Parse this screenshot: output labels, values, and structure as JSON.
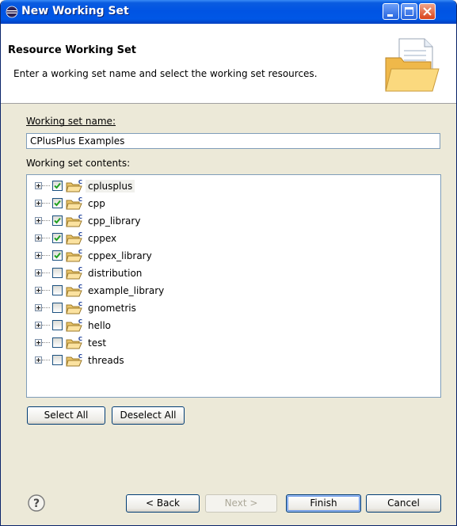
{
  "window": {
    "title": "New Working Set"
  },
  "banner": {
    "title": "Resource Working Set",
    "description": "Enter a working set name and select the working set resources."
  },
  "form": {
    "name_label": "Working set name:",
    "name_value": "CPlusPlus Examples",
    "contents_label": "Working set contents:"
  },
  "tree": {
    "items": [
      {
        "label": "cplusplus",
        "checked": true,
        "selected": true
      },
      {
        "label": "cpp",
        "checked": true,
        "selected": false
      },
      {
        "label": "cpp_library",
        "checked": true,
        "selected": false
      },
      {
        "label": "cppex",
        "checked": true,
        "selected": false
      },
      {
        "label": "cppex_library",
        "checked": true,
        "selected": false
      },
      {
        "label": "distribution",
        "checked": false,
        "selected": false
      },
      {
        "label": "example_library",
        "checked": false,
        "selected": false
      },
      {
        "label": "gnometris",
        "checked": false,
        "selected": false
      },
      {
        "label": "hello",
        "checked": false,
        "selected": false
      },
      {
        "label": "test",
        "checked": false,
        "selected": false
      },
      {
        "label": "threads",
        "checked": false,
        "selected": false
      }
    ]
  },
  "buttons": {
    "select_all": "Select All",
    "deselect_all": "Deselect All",
    "back": "< Back",
    "next": "Next >",
    "finish": "Finish",
    "cancel": "Cancel"
  },
  "icons": {
    "title": "eclipse-icon",
    "banner": "folder-wizard-icon",
    "project": "cpp-project-folder-icon",
    "help": "help-icon"
  },
  "colors": {
    "titlebar": "#0054e3",
    "check": "#21a121",
    "dialog_bg": "#ece9d8"
  }
}
